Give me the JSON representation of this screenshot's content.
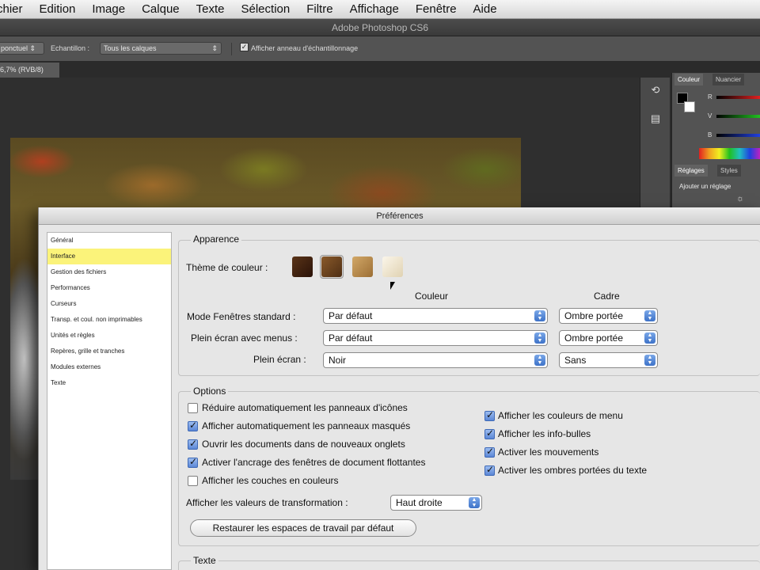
{
  "menu": [
    "chier",
    "Edition",
    "Image",
    "Calque",
    "Texte",
    "Sélection",
    "Filtre",
    "Affichage",
    "Fenêtre",
    "Aide"
  ],
  "app_title": "Adobe Photoshop CS6",
  "options_bar": {
    "mode_select": "ponctuel",
    "sample_label": "Echantillon :",
    "sample_value": "Tous les calques",
    "ring_checkbox_label": "Afficher anneau d'échantillonnage"
  },
  "document_tab": "6,7% (RVB/8)",
  "right_panel": {
    "tabs_top": [
      "Couleur",
      "Nuancier"
    ],
    "slider_labels": [
      "R",
      "V",
      "B"
    ],
    "tabs_bottom": [
      "Réglages",
      "Styles"
    ],
    "adjust_text": "Ajouter un réglage"
  },
  "dialog": {
    "title": "Préférences",
    "sidebar": [
      "Général",
      "Interface",
      "Gestion des fichiers",
      "Performances",
      "Curseurs",
      "Transp. et coul. non imprimables",
      "Unités et règles",
      "Repères, grille et tranches",
      "Modules externes",
      "Texte"
    ],
    "selected_index": 1,
    "apparence": {
      "label": "Apparence",
      "theme_label": "Thème de couleur :",
      "themes": [
        "#3a1f10",
        "#6b4220",
        "#b98a4a",
        "#efe6d0"
      ],
      "col_couleur": "Couleur",
      "col_cadre": "Cadre",
      "rows": [
        {
          "label": "Mode Fenêtres standard :",
          "color": "Par défaut",
          "frame": "Ombre portée"
        },
        {
          "label": "Plein écran avec menus :",
          "color": "Par défaut",
          "frame": "Ombre portée"
        },
        {
          "label": "Plein écran :",
          "color": "Noir",
          "frame": "Sans"
        }
      ]
    },
    "options": {
      "label": "Options",
      "left": [
        {
          "label": "Réduire automatiquement les panneaux d'icônes",
          "checked": false
        },
        {
          "label": "Afficher automatiquement les panneaux masqués",
          "checked": true
        },
        {
          "label": "Ouvrir les documents dans de nouveaux onglets",
          "checked": true
        },
        {
          "label": "Activer l'ancrage des fenêtres de document flottantes",
          "checked": true
        },
        {
          "label": "Afficher les couches en couleurs",
          "checked": false
        }
      ],
      "right": [
        {
          "label": "Afficher les couleurs de menu",
          "checked": true
        },
        {
          "label": "Afficher les info-bulles",
          "checked": true
        },
        {
          "label": "Activer les mouvements",
          "checked": true
        },
        {
          "label": "Activer les ombres portées du texte",
          "checked": true
        }
      ],
      "transform_label": "Afficher les valeurs de transformation :",
      "transform_value": "Haut droite",
      "restore_button": "Restaurer les espaces de travail par défaut"
    },
    "texte_label": "Texte"
  }
}
